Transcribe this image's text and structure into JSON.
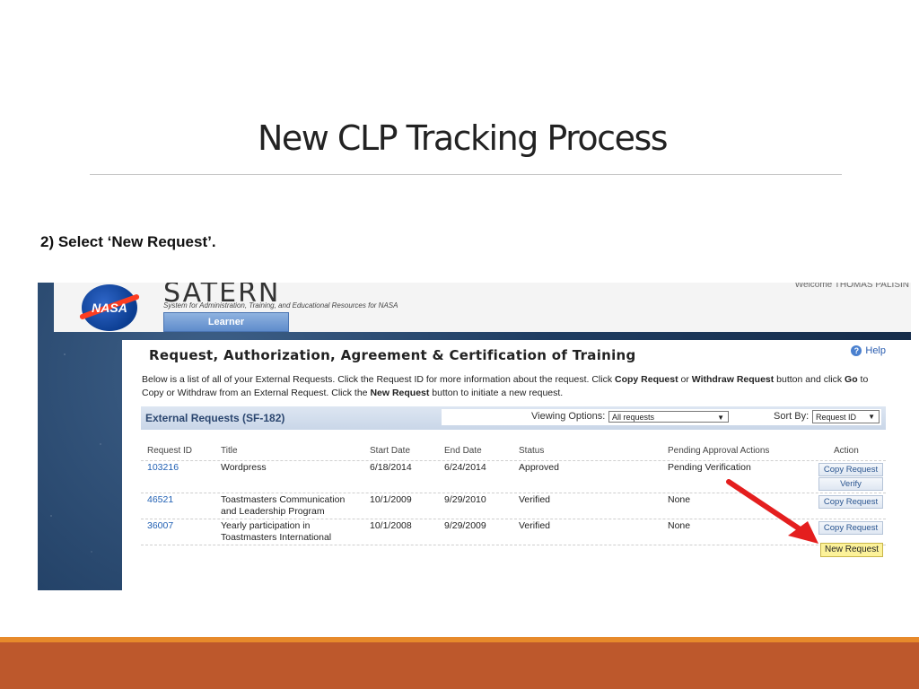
{
  "slide": {
    "title": "New CLP Tracking Process",
    "step": "2)  Select ‘New Request’."
  },
  "header": {
    "logo_text": "NASA",
    "app_name": "SATERN",
    "tagline": "System for Administration, Training, and Educational Resources for NASA",
    "welcome": "Welcome THOMAS PALISIN",
    "tab": "Learner"
  },
  "panel": {
    "title": "Request, Authorization, Agreement & Certification of Training",
    "help": "Help",
    "desc_1": "Below is a list of all of your External Requests. Click the Request ID for more information about the request. Click ",
    "desc_copy": "Copy Request",
    "desc_2": " or ",
    "desc_withdraw": "Withdraw Request",
    "desc_3": " button and click ",
    "desc_go": "Go",
    "desc_4": " to Copy or Withdraw from an External Request. Click the ",
    "desc_new": "New Request",
    "desc_5": " button to initiate a new request."
  },
  "grid": {
    "title": "External Requests (SF-182)",
    "viewing_label": "Viewing Options:",
    "viewing_value": "All requests",
    "sort_label": "Sort By:",
    "sort_value": "Request ID",
    "columns": [
      "Request ID",
      "Title",
      "Start Date",
      "End Date",
      "Status",
      "Pending Approval Actions",
      "Action"
    ],
    "rows": [
      {
        "id": "103216",
        "title": "Wordpress",
        "start": "6/18/2014",
        "end": "6/24/2014",
        "status": "Approved",
        "pending": "Pending Verification",
        "actions": [
          "Copy Request",
          "Verify"
        ]
      },
      {
        "id": "46521",
        "title": "Toastmasters Communication and Leadership Program",
        "start": "10/1/2009",
        "end": "9/29/2010",
        "status": "Verified",
        "pending": "None",
        "actions": [
          "Copy Request"
        ]
      },
      {
        "id": "36007",
        "title": "Yearly participation in Toastmasters International",
        "start": "10/1/2008",
        "end": "9/29/2009",
        "status": "Verified",
        "pending": "None",
        "actions": [
          "Copy Request"
        ]
      }
    ],
    "new_request": "New Request"
  },
  "colors": {
    "accent_bar": "#bd582c",
    "accent_stripe": "#e78a2b",
    "arrow": "#e41e1e",
    "new_request_bg": "#fcf29a"
  }
}
